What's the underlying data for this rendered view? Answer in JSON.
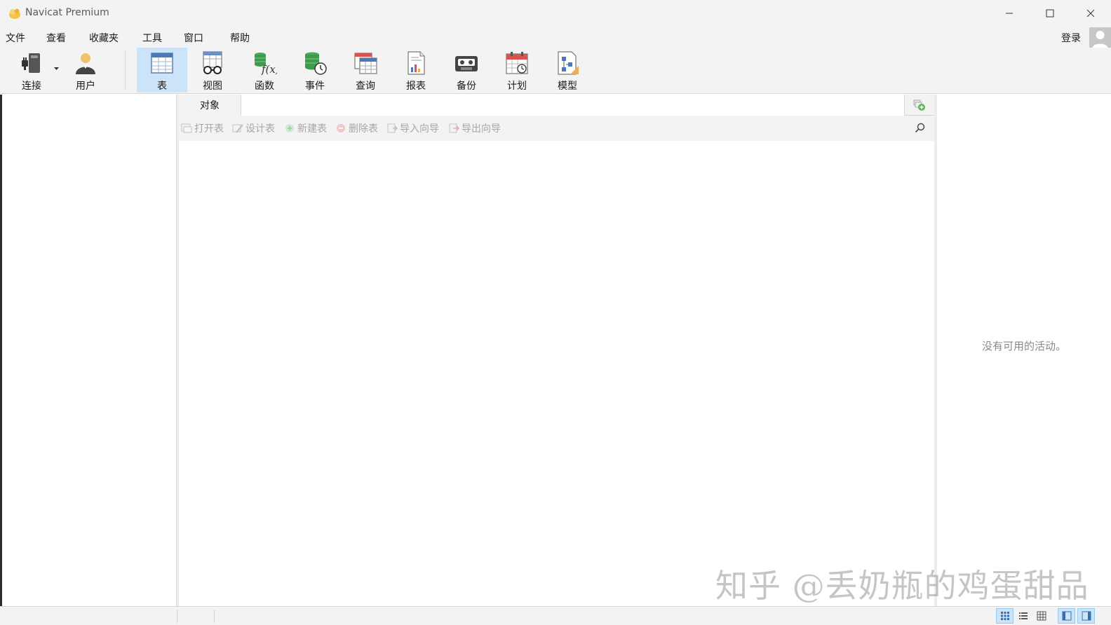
{
  "window": {
    "title": "Navicat Premium"
  },
  "menu": [
    "文件",
    "查看",
    "收藏夹",
    "工具",
    "窗口",
    "帮助"
  ],
  "account": {
    "login_label": "登录"
  },
  "toolbar": {
    "connect": "连接",
    "user": "用户",
    "table": "表",
    "view": "视图",
    "function": "函数",
    "event": "事件",
    "query": "查询",
    "report": "报表",
    "backup": "备份",
    "schedule": "计划",
    "model": "模型",
    "active": "table"
  },
  "tabs": {
    "objects": "对象"
  },
  "actions": {
    "open_table": "打开表",
    "design_table": "设计表",
    "new_table": "新建表",
    "delete_table": "删除表",
    "import_wizard": "导入向导",
    "export_wizard": "导出向导"
  },
  "info_panel": {
    "empty_message": "没有可用的活动。"
  },
  "watermark": "知乎 @丢奶瓶的鸡蛋甜品",
  "colors": {
    "accent_selected": "#cce4f7",
    "disabled_text": "#a6a6a6",
    "chrome_bg": "#f3f3f3"
  }
}
